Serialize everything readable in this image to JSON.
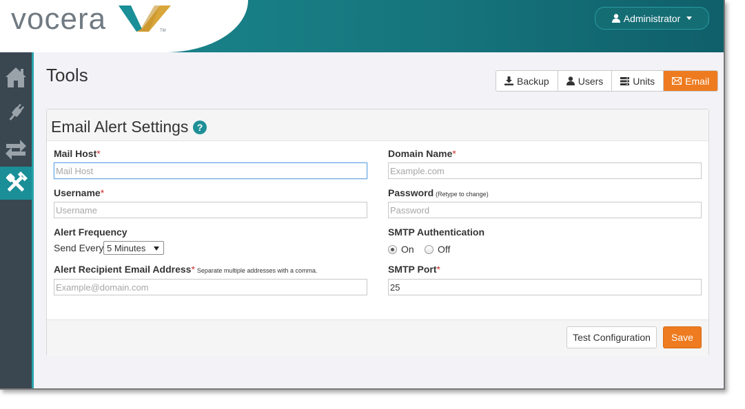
{
  "header": {
    "logo_text": "vocera",
    "user_menu_label": "Administrator",
    "colors": {
      "teal": "#1a8f97",
      "orange": "#ee7b1f",
      "gold": "#d9a63a"
    }
  },
  "sidebar": {
    "items": [
      {
        "icon": "home-icon"
      },
      {
        "icon": "plug-icon"
      },
      {
        "icon": "transfer-arrows-icon"
      },
      {
        "icon": "tools-icon",
        "active": true
      }
    ]
  },
  "page": {
    "title": "Tools"
  },
  "tabs": [
    {
      "label": "Backup",
      "icon": "download-icon"
    },
    {
      "label": "Users",
      "icon": "user-icon"
    },
    {
      "label": "Units",
      "icon": "server-icon"
    },
    {
      "label": "Email",
      "icon": "envelope-icon",
      "active": true
    }
  ],
  "panel": {
    "title": "Email Alert Settings",
    "help_glyph": "?"
  },
  "form": {
    "mail_host": {
      "label": "Mail Host",
      "required": "*",
      "placeholder": "Mail Host",
      "value": ""
    },
    "domain_name": {
      "label": "Domain Name",
      "required": "*",
      "placeholder": "Example.com",
      "value": ""
    },
    "username": {
      "label": "Username",
      "required": "*",
      "placeholder": "Username",
      "value": ""
    },
    "password": {
      "label": "Password",
      "hint": "(Retype to change)",
      "placeholder": "Password",
      "value": ""
    },
    "alert_frequency": {
      "label": "Alert Frequency",
      "prefix": "Send Every",
      "selected": "5 Minutes"
    },
    "smtp_auth": {
      "label": "SMTP Authentication",
      "on_label": "On",
      "off_label": "Off",
      "selected": "On"
    },
    "recipients": {
      "label": "Alert Recipient Email Address",
      "required": "*",
      "hint": "Separate multiple addresses with a comma.",
      "placeholder": "Example@domain.com",
      "value": ""
    },
    "smtp_port": {
      "label": "SMTP Port",
      "required": "*",
      "value": "25"
    }
  },
  "footer": {
    "test_label": "Test Configuration",
    "save_label": "Save"
  }
}
